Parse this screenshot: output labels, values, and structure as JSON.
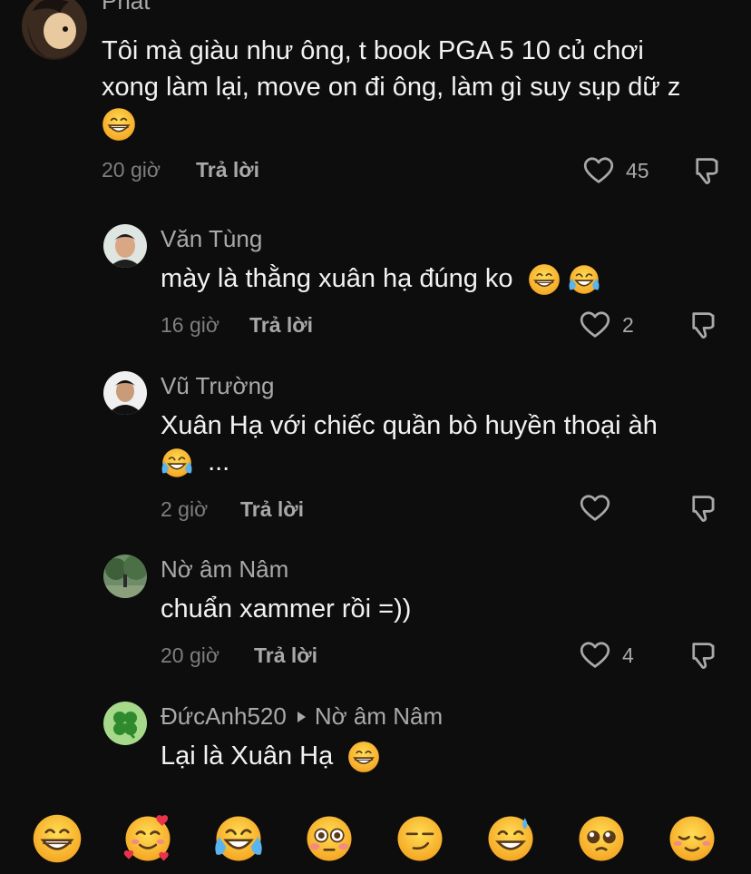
{
  "comments": [
    {
      "author": "Phát",
      "text_lines": [
        "Tôi mà giàu như ông, t book PGA 5 10 củ chơi",
        "xong làm lại, move on đi ông, làm gì suy sụp dữ z"
      ],
      "time": "20 giờ",
      "reply_label": "Trả lời",
      "likes": "45"
    },
    {
      "author": "Văn Tùng",
      "text": "mày là thằng xuân hạ đúng ko",
      "time": "16 giờ",
      "reply_label": "Trả lời",
      "likes": "2"
    },
    {
      "author": "Vũ Trường",
      "text": "Xuân Hạ với chiếc quần bò huyền thoại àh",
      "text_more": "...",
      "time": "2 giờ",
      "reply_label": "Trả lời",
      "likes": ""
    },
    {
      "author": "Nờ âm Nâm",
      "text": "chuẩn xammer rồi =))",
      "time": "20 giờ",
      "reply_label": "Trả lời",
      "likes": "4"
    },
    {
      "author": "ĐứcAnh520",
      "reply_to": "Nờ âm Nâm",
      "text": "Lại là Xuân Hạ"
    }
  ],
  "emoji_bar": [
    "grinning",
    "smiling-hearts",
    "tears-of-joy",
    "flushed",
    "smirk",
    "sweat-smile",
    "pleading",
    "relieved"
  ],
  "colors": {
    "background": "#0d0d0d",
    "text": "#f2f2f2",
    "secondary": "#a9a9a9",
    "muted": "#7e7e7e",
    "emoji": "#fbc531"
  }
}
